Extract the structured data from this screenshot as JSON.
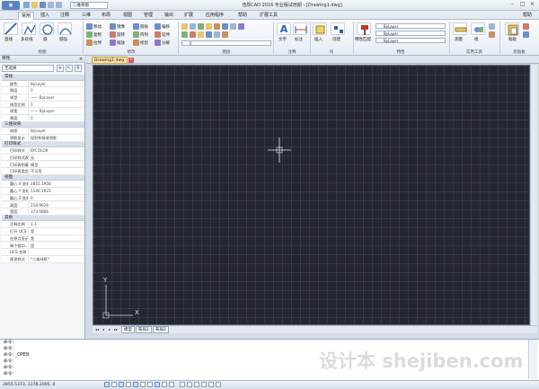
{
  "app": {
    "title": "浩辰CAD 2016 专业版试用期 - [Drawing1.dwg]",
    "menu_button": ""
  },
  "quick_access": {
    "workspace": "二维草图"
  },
  "window_controls": {
    "minimize": "–",
    "maximize": "□",
    "close": "×"
  },
  "ribbon": {
    "tabs": [
      "常用",
      "插入",
      "注释",
      "三维",
      "布局",
      "视图",
      "管理",
      "输出",
      "扩展",
      "应用程序",
      "帮助",
      "扩展工具"
    ],
    "active_tab": "常用",
    "help_label": "帮助",
    "groups": {
      "draw": {
        "label": "绘图",
        "big": [
          "直线",
          "多段线",
          "圆",
          "圆弧"
        ]
      },
      "modify": {
        "label": "修改",
        "items": [
          "移动",
          "复制",
          "拉伸",
          "镜像",
          "旋转",
          "缩放",
          "圆角",
          "阵列",
          "修剪",
          "偏移",
          "延伸",
          "分解"
        ]
      },
      "layers": {
        "label": "图层",
        "combo": "0"
      },
      "annotation": {
        "label": "注释",
        "big": [
          "文字",
          "标注"
        ]
      },
      "block": {
        "label": "块",
        "big": [
          "插入",
          "创建"
        ]
      },
      "properties": {
        "label": "特性",
        "combos": [
          "ByLayer",
          "ByLayer",
          "ByLayer"
        ],
        "big": "特性匹配"
      },
      "utilities": {
        "label": "实用工具",
        "big": [
          "测量",
          "组"
        ]
      },
      "clipboard": {
        "label": "剪贴板",
        "big": [
          "粘贴"
        ]
      }
    }
  },
  "properties_panel": {
    "title": "特性",
    "close": "×",
    "selection": "无选择",
    "sections": [
      {
        "name": "常规",
        "rows": [
          [
            "颜色",
            "ByLayer"
          ],
          [
            "图层",
            "0"
          ],
          [
            "线型",
            "—— ByLayer"
          ],
          [
            "线型比例",
            "1"
          ],
          [
            "线宽",
            "—— ByLayer"
          ],
          [
            "厚度",
            "0"
          ]
        ]
      },
      {
        "name": "三维效果",
        "rows": [
          [
            "材质",
            "ByLayer"
          ],
          [
            "阴影显示",
            "投射和接收阴影"
          ]
        ]
      },
      {
        "name": "打印样式",
        "rows": [
          [
            "打印样式",
            "BYCOLOR"
          ],
          [
            "打印样式表",
            "无"
          ],
          [
            "打印表附着到",
            "模型"
          ],
          [
            "打印表类型",
            "不可用"
          ]
        ]
      },
      {
        "name": "视图",
        "rows": [
          [
            "圆心 X 坐标",
            "2855.1958"
          ],
          [
            "圆心 Y 坐标",
            "1140.1925"
          ],
          [
            "圆心 Z 坐标",
            "0"
          ],
          [
            "高度",
            "218.9626"
          ],
          [
            "宽度",
            "373.5886"
          ]
        ]
      },
      {
        "name": "其他",
        "rows": [
          [
            "注释比例",
            "1:1"
          ],
          [
            "打开 UCS ...",
            "是"
          ],
          [
            "在原点显示...",
            "是"
          ],
          [
            "每个视口...",
            "是"
          ],
          [
            "UCS 名称",
            ""
          ],
          [
            "视觉样式",
            "*二维线框*"
          ]
        ]
      }
    ]
  },
  "document": {
    "tab": "Drawing1.dwg",
    "close": "×"
  },
  "layout_tabs": {
    "nav": [
      "◂◂",
      "◂",
      "▸",
      "▸▸"
    ],
    "tabs": [
      "模型",
      "布局1",
      "布局2"
    ],
    "active": "模型"
  },
  "ucs_icon": {
    "x_label": "X",
    "y_label": "Y"
  },
  "command_lines": [
    "命令:",
    "命令:",
    "命令: _OPEN",
    "命令:",
    "命令:",
    "命令:"
  ],
  "status": {
    "coords": "2855.5373, 1178.2005, 0"
  },
  "colors": {
    "canvas_bg": "#24272f",
    "accent": "#5a84c4",
    "doc_tab": "#fbe3a7"
  },
  "watermark": "设计本 shejiben.com"
}
